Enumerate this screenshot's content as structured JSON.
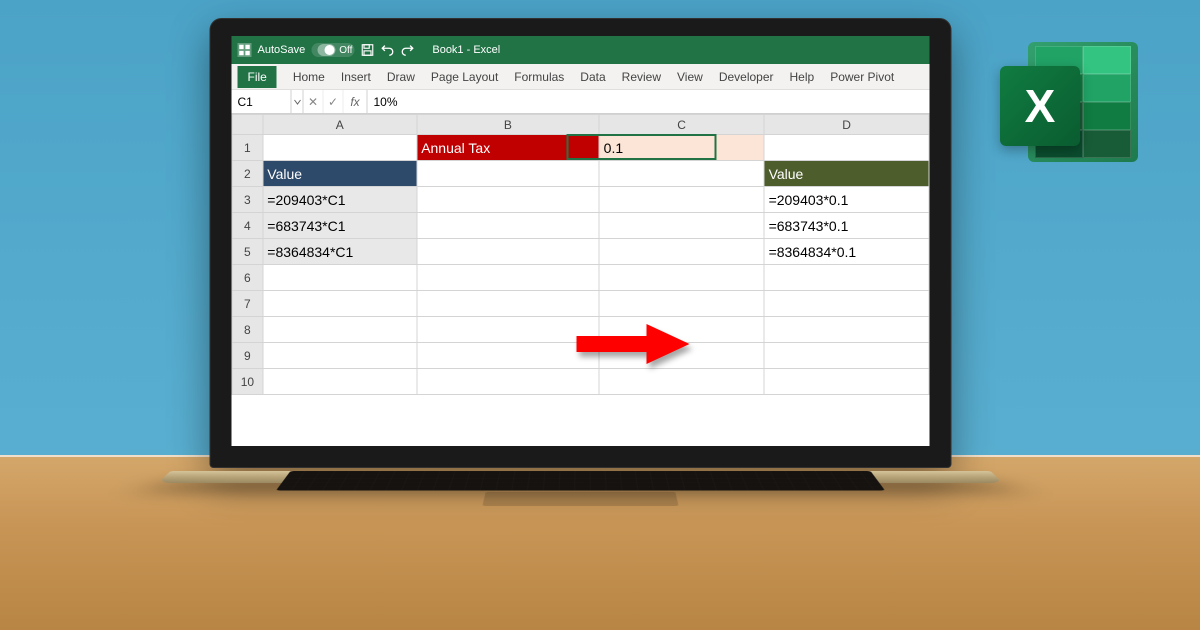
{
  "titlebar": {
    "autosave_label": "AutoSave",
    "autosave_state": "Off",
    "doc_title": "Book1 - Excel"
  },
  "ribbon": {
    "tabs": [
      "File",
      "Home",
      "Insert",
      "Draw",
      "Page Layout",
      "Formulas",
      "Data",
      "Review",
      "View",
      "Developer",
      "Help",
      "Power Pivot"
    ]
  },
  "formula_bar": {
    "namebox": "C1",
    "fx": "fx",
    "value": "10%"
  },
  "grid": {
    "columns": [
      "A",
      "B",
      "C",
      "D"
    ],
    "rows": [
      "1",
      "2",
      "3",
      "4",
      "5",
      "6",
      "7",
      "8",
      "9",
      "10"
    ],
    "cells": {
      "B1": "Annual Tax",
      "C1": "0.1",
      "A2": "Value",
      "A3": "=209403*C1",
      "A4": "=683743*C1",
      "A5": "=8364834*C1",
      "D2": "Value",
      "D3": "=209403*0.1",
      "D4": "=683743*0.1",
      "D5": "=8364834*0.1"
    }
  },
  "logo": {
    "letter": "X"
  }
}
